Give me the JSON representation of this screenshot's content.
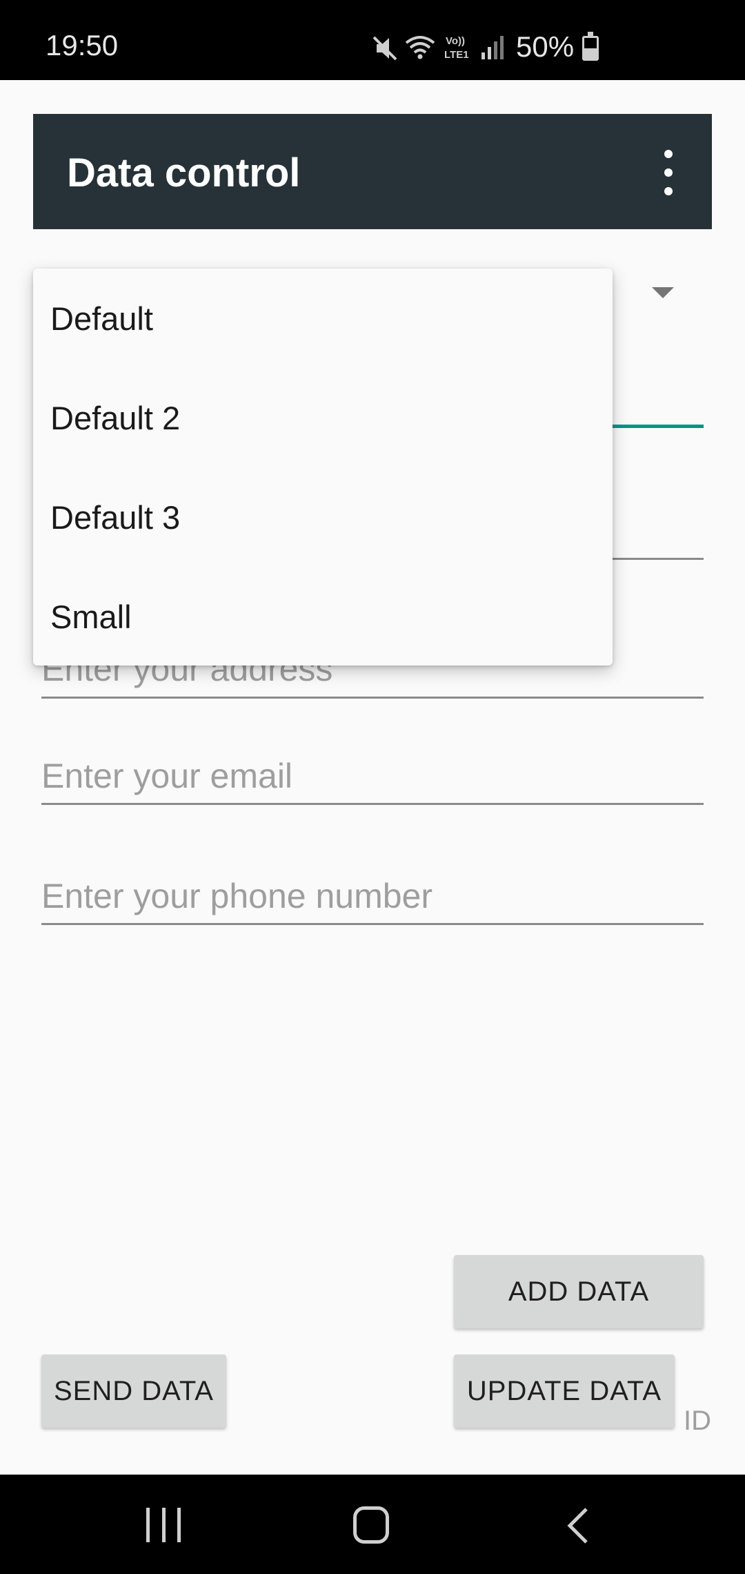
{
  "status_bar": {
    "time": "19:50",
    "battery_text": "50%",
    "icons": [
      "mute-icon",
      "wifi-icon",
      "volte-icon",
      "signal-icon",
      "battery-icon"
    ]
  },
  "app_bar": {
    "title": "Data control",
    "menu_icon": "overflow-menu-icon"
  },
  "dropdown": {
    "items": [
      {
        "label": "Default"
      },
      {
        "label": "Default 2"
      },
      {
        "label": "Default 3"
      },
      {
        "label": "Small"
      }
    ]
  },
  "form": {
    "address_placeholder": "Enter your address",
    "email_placeholder": "Enter your email",
    "phone_placeholder": "Enter your phone number"
  },
  "buttons": {
    "add": "ADD DATA",
    "send": "SEND DATA",
    "update": "UPDATE DATA"
  },
  "id_label": "ID",
  "colors": {
    "app_bar": "#263238",
    "accent": "#009688",
    "button": "#d6d7d7"
  }
}
